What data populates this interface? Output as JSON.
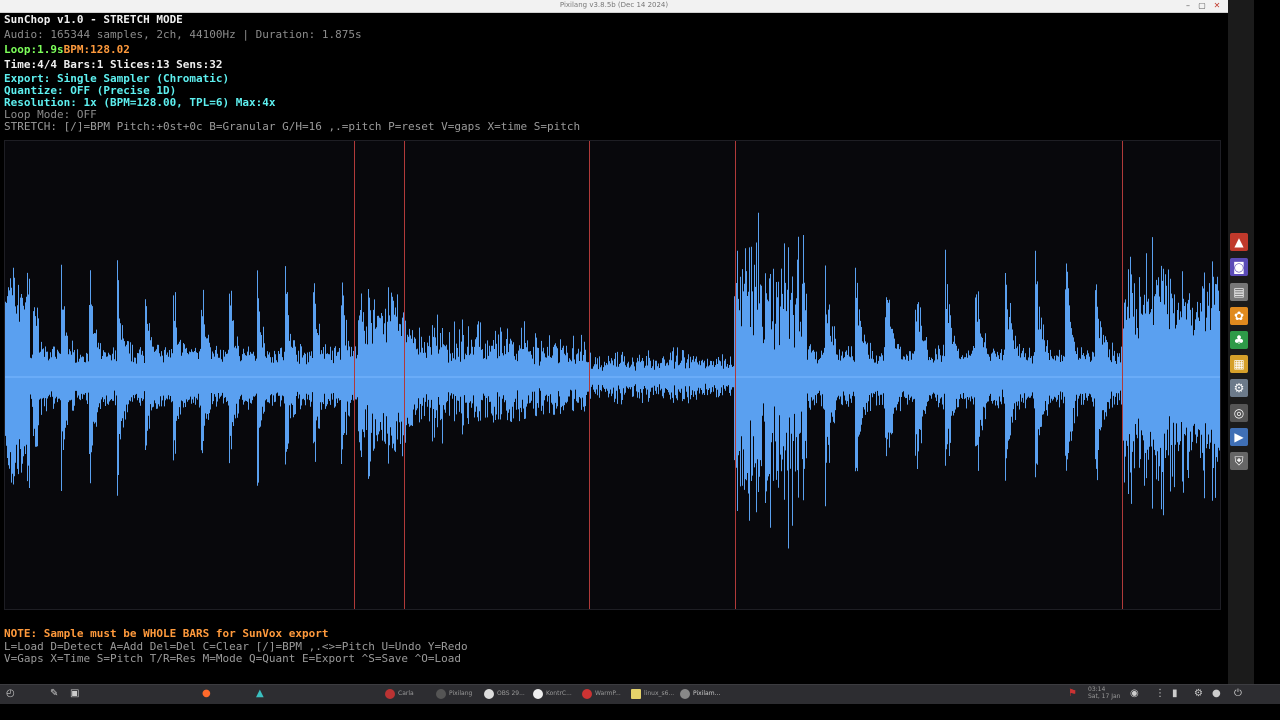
{
  "window": {
    "title": "Pixilang v3.8.5b (Dec 14 2024)",
    "controls": [
      "–",
      "▢",
      "✕"
    ]
  },
  "header": {
    "app_title": "SunChop v1.0 - STRETCH MODE",
    "audio_info": "Audio: 165344 samples, 2ch, 44100Hz | Duration: 1.875s",
    "loop_label": "Loop:1.9s",
    "bpm_label": "BPM:128.02",
    "time_info": "Time:4/4 Bars:1 Slices:13 Sens:32",
    "export": "Export: Single Sampler (Chromatic)",
    "quantize": "Quantize: OFF (Precise 1D)",
    "resolution": "Resolution: 1x (BPM=128.00, TPL=6) Max:4x",
    "loop_mode": "Loop Mode: OFF",
    "stretch_help": "STRETCH: [/]=BPM Pitch:+0st+0c B=Granular G/H=16 ,.=pitch P=reset V=gaps X=time S=pitch"
  },
  "waveform": {
    "color": "#5aa0f0",
    "background": "#08080c",
    "slice_color": "#b03a3a",
    "slice_positions": [
      0.287,
      0.328,
      0.481,
      0.601,
      0.919
    ]
  },
  "footer": {
    "note": "NOTE: Sample must be WHOLE BARS for SunVox export",
    "keys1": "L=Load D=Detect A=Add Del=Del C=Clear [/]=BPM ,.<>=Pitch U=Undo Y=Redo",
    "keys2": "V=Gaps X=Time S=Pitch T/R=Res M=Mode Q=Quant E=Export ^S=Save ^O=Load"
  },
  "taskbar": {
    "items": [
      "Carla",
      "Pixilang",
      "OBS 29...",
      "KontrC...",
      "WarmP...",
      "linux_s6...",
      "Pixilam..."
    ],
    "clock": "03:14",
    "date": "Sat, 17 Jan"
  },
  "sidebar_icons": [
    "app-red-icon",
    "app-purple-icon",
    "app-gray-icon",
    "app-orange-icon",
    "app-green-icon",
    "app-grid-icon",
    "app-settings-icon",
    "app-round-icon",
    "app-screen-icon",
    "app-shield-icon"
  ]
}
